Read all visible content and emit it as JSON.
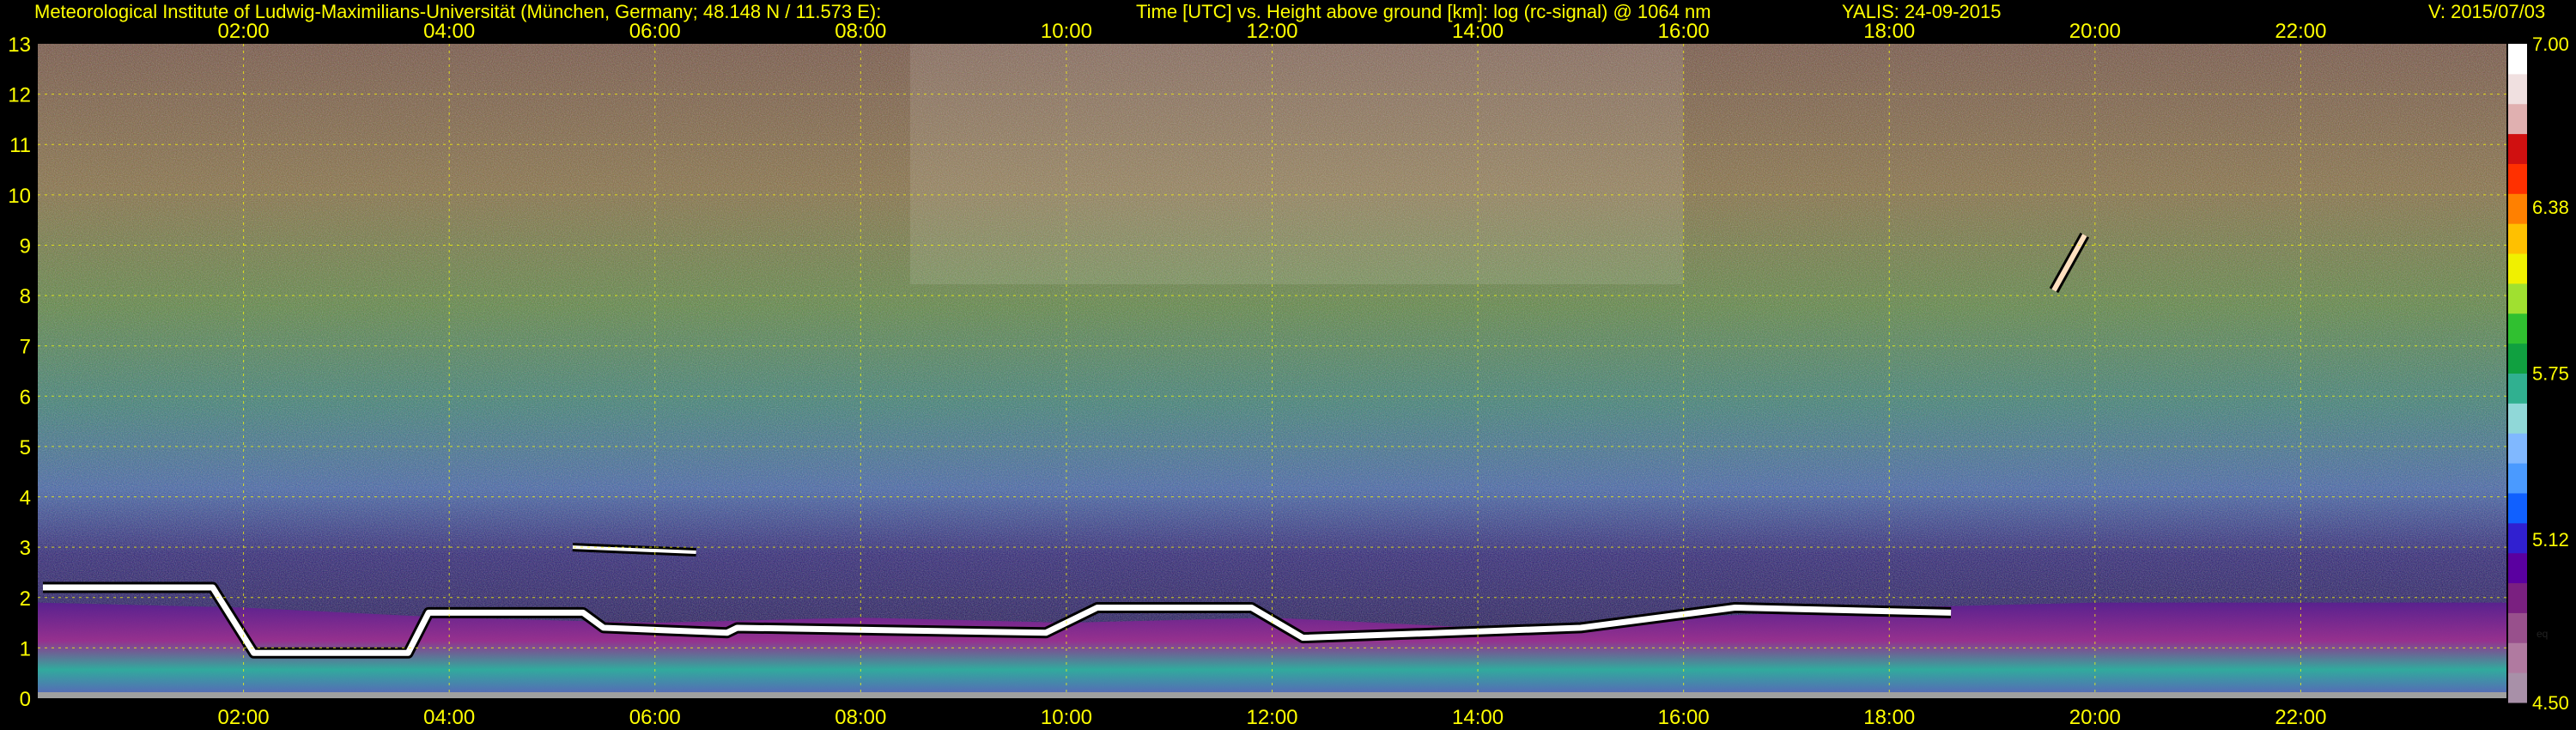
{
  "header": {
    "institute": "Meteorological Institute of Ludwig-Maximilians-Universität (München, Germany; 48.148 N / 11.573 E):",
    "title": "Time [UTC] vs. Height above ground [km]: log (rc-signal) @ 1064 nm",
    "station_date": "YALIS: 24-09-2015",
    "version": "V: 2015/07/03"
  },
  "colors": {
    "text": "#ffff00",
    "grid": "#ffff00",
    "background": "#000000"
  },
  "chart_data": {
    "type": "heatmap",
    "title": "Time [UTC] vs. Height above ground [km]: log (rc-signal) @ 1064 nm",
    "xlabel": "",
    "ylabel": "",
    "x_ticks": [
      "02:00",
      "04:00",
      "06:00",
      "08:00",
      "10:00",
      "12:00",
      "14:00",
      "16:00",
      "18:00",
      "20:00",
      "22:00"
    ],
    "x_tick_hours": [
      2,
      4,
      6,
      8,
      10,
      12,
      14,
      16,
      18,
      20,
      22
    ],
    "xlim_hours": [
      0,
      24
    ],
    "y_ticks": [
      "0",
      "1",
      "2",
      "3",
      "4",
      "5",
      "6",
      "7",
      "8",
      "9",
      "10",
      "11",
      "12",
      "13"
    ],
    "y_tick_values": [
      0,
      1,
      2,
      3,
      4,
      5,
      6,
      7,
      8,
      9,
      10,
      11,
      12,
      13
    ],
    "ylim": [
      0,
      13
    ],
    "grid": true,
    "colorbar": {
      "range": [
        4.5,
        7.0
      ],
      "tick_labels": [
        "7.00",
        "6.38",
        "5.75",
        "5.12",
        "4.50"
      ],
      "tick_values": [
        7.0,
        6.38,
        5.75,
        5.12,
        4.5
      ],
      "annotation": "eq",
      "colors": [
        "#a890a8",
        "#b07aa0",
        "#98508c",
        "#7a2080",
        "#5a00a0",
        "#3020d0",
        "#1060ff",
        "#4a9aff",
        "#80b8ff",
        "#90d8d8",
        "#30b090",
        "#10a040",
        "#30c030",
        "#a0e030",
        "#f0f000",
        "#ffc000",
        "#ff8000",
        "#ff3000",
        "#d01010",
        "#e0b0b0",
        "#f0e0e0",
        "#ffffff"
      ]
    },
    "layers": [
      {
        "name": "boundary layer",
        "x_hours": [
          0,
          2,
          4,
          6,
          8,
          10,
          12,
          14,
          16,
          18,
          20,
          22,
          24
        ],
        "top_km": [
          1.9,
          1.8,
          1.6,
          1.5,
          1.6,
          1.5,
          1.6,
          1.4,
          1.6,
          1.8,
          1.9,
          1.9,
          1.9
        ]
      },
      {
        "name": "cloud base",
        "x_hours": [
          0.05,
          1.7,
          2.1,
          3.6,
          3.8,
          5.3,
          5.5,
          6.7,
          6.8,
          9.8,
          10.3,
          11.8,
          12.3,
          15.0,
          16.5,
          18.6
        ],
        "height_km": [
          2.2,
          2.2,
          0.9,
          0.9,
          1.7,
          1.7,
          1.4,
          1.3,
          1.4,
          1.3,
          1.8,
          1.8,
          1.2,
          1.4,
          1.8,
          1.7
        ]
      },
      {
        "name": "elevated layer",
        "x_hours": [
          5.2,
          6.4
        ],
        "height_km": [
          3.0,
          2.9
        ]
      },
      {
        "name": "cirrus",
        "x_hours": [
          19.6,
          19.9
        ],
        "height_km": [
          8.1,
          9.2
        ]
      }
    ]
  }
}
